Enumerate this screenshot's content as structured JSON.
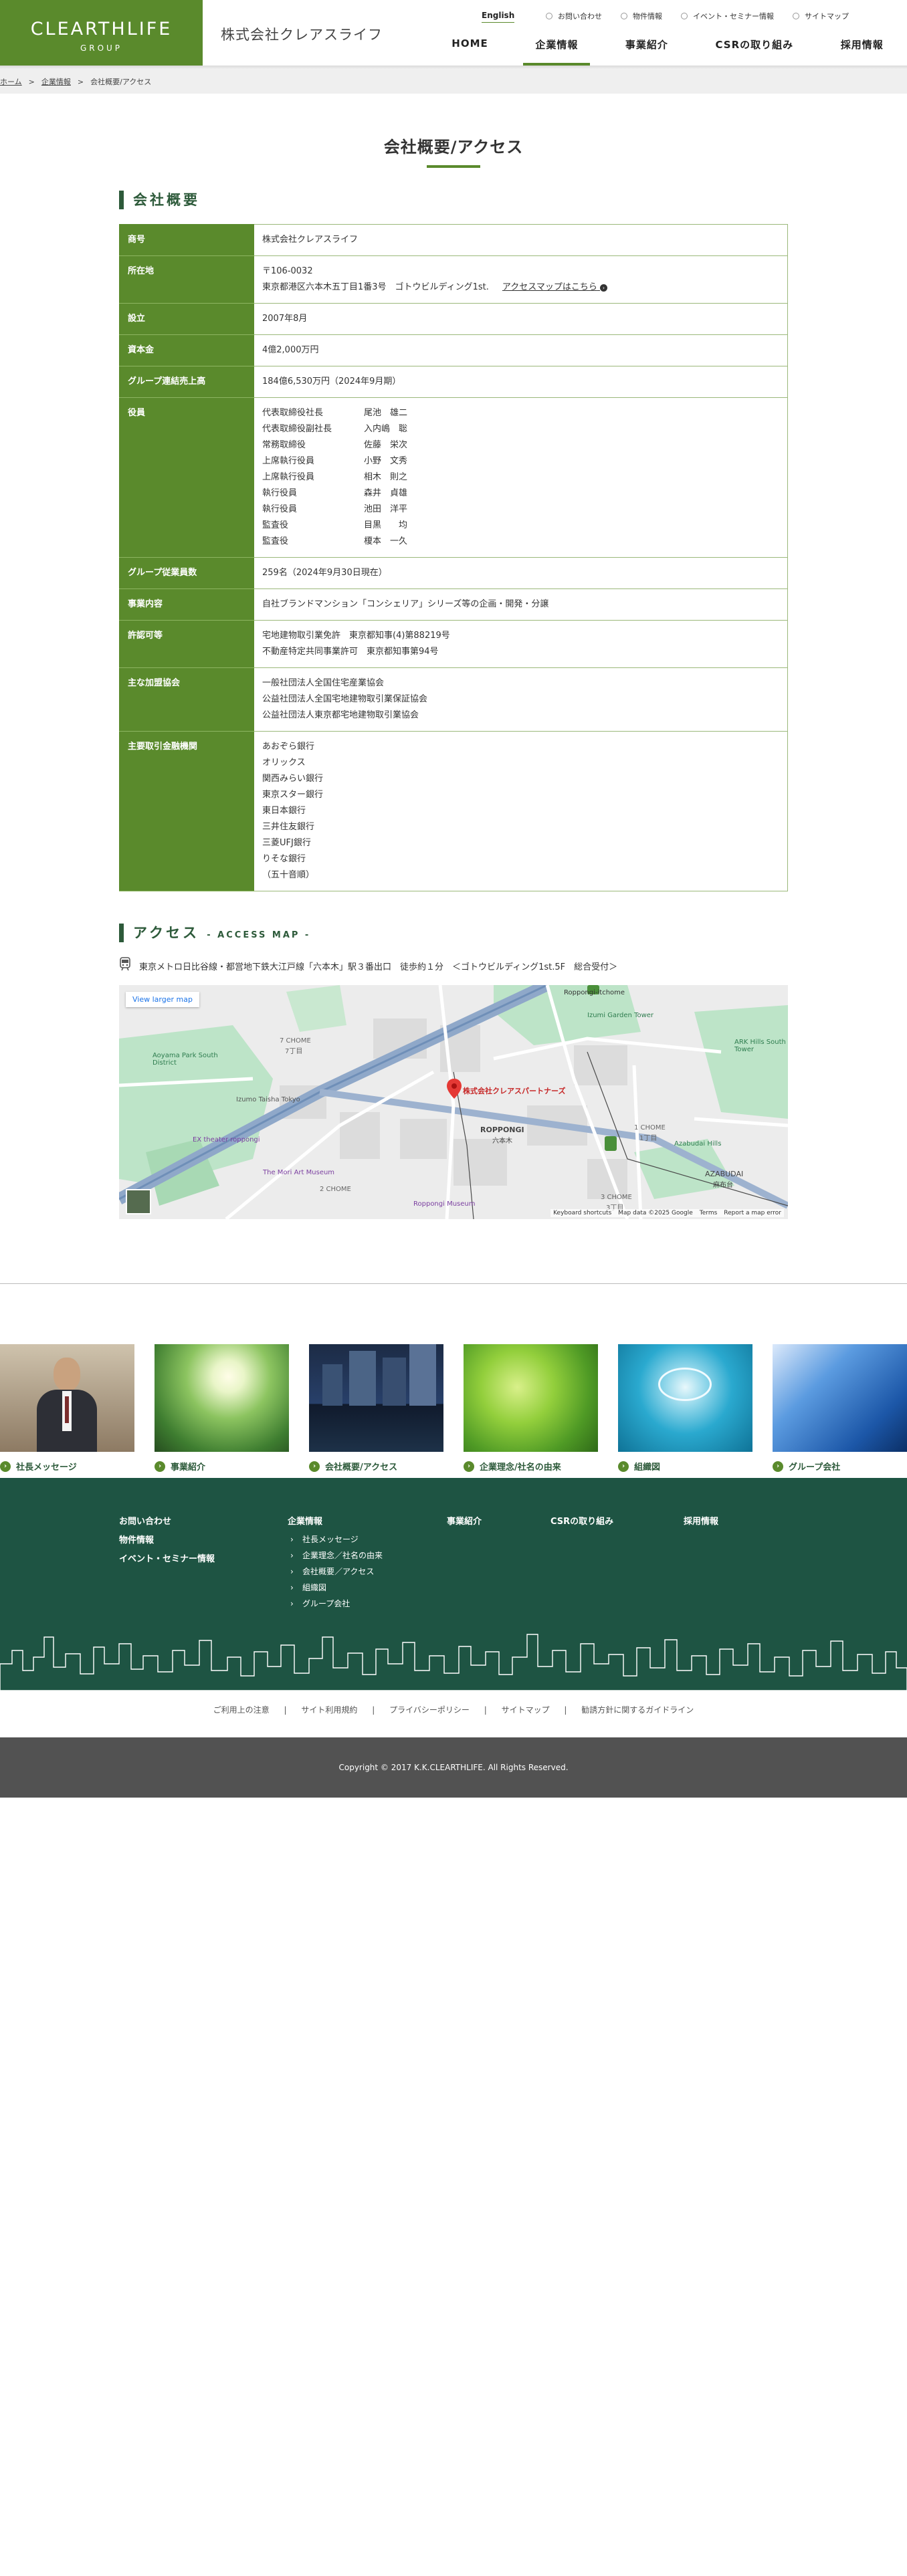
{
  "header": {
    "logo_main": "CLEARTHLIFE",
    "logo_sub": "GROUP",
    "company_name": "株式会社クレアスライフ",
    "english": "English",
    "util_nav": [
      "お問い合わせ",
      "物件情報",
      "イベント・セミナー情報",
      "サイトマップ"
    ],
    "global_nav": [
      "HOME",
      "企業情報",
      "事業紹介",
      "CSRの取り組み",
      "採用情報"
    ],
    "active_nav": "企業情報"
  },
  "breadcrumb": {
    "items": [
      "ホーム",
      "企業情報",
      "会社概要/アクセス"
    ],
    "separator": ">"
  },
  "page": {
    "title": "会社概要/アクセス",
    "company_section": "会社概要",
    "access_section": "アクセス",
    "access_sub": "- ACCESS MAP -"
  },
  "company_table": {
    "trade_name_label": "商号",
    "trade_name": "株式会社クレアスライフ",
    "address_label": "所在地",
    "postal": "〒106-0032",
    "address": "東京都港区六本木五丁目1番3号　ゴトウビルディング1st.",
    "map_link": "アクセスマップはこちら",
    "established_label": "設立",
    "established": "2007年8月",
    "capital_label": "資本金",
    "capital": "4億2,000万円",
    "sales_label": "グループ連結売上高",
    "sales": "184億6,530万円（2024年9月期）",
    "officers_label": "役員",
    "officers": [
      {
        "role": "代表取締役社長",
        "name": "尾池　雄二"
      },
      {
        "role": "代表取締役副社長",
        "name": "入内嶋　聡"
      },
      {
        "role": "常務取締役",
        "name": "佐藤　栄次"
      },
      {
        "role": "上席執行役員",
        "name": "小野　文秀"
      },
      {
        "role": "上席執行役員",
        "name": "相木　則之"
      },
      {
        "role": "執行役員",
        "name": "森井　貞雄"
      },
      {
        "role": "執行役員",
        "name": "池田　洋平"
      },
      {
        "role": "監査役",
        "name": "目黒　　均"
      },
      {
        "role": "監査役",
        "name": "榎本　一久"
      }
    ],
    "employees_label": "グループ従業員数",
    "employees": "259名（2024年9月30日現在）",
    "business_label": "事業内容",
    "business": "自社ブランドマンション「コンシェリア」シリーズ等の企画・開発・分譲",
    "license_label": "許認可等",
    "licenses": [
      "宅地建物取引業免許　東京都知事(4)第88219号",
      "不動産特定共同事業許可　東京都知事第94号"
    ],
    "associations_label": "主な加盟協会",
    "associations": [
      "一般社団法人全国住宅産業協会",
      "公益社団法人全国宅地建物取引業保証協会",
      "公益社団法人東京都宅地建物取引業協会"
    ],
    "banks_label": "主要取引金融機関",
    "banks": [
      "あおぞら銀行",
      "オリックス",
      "関西みらい銀行",
      "東京スター銀行",
      "東日本銀行",
      "三井住友銀行",
      "三菱UFJ銀行",
      "りそな銀行",
      "（五十音順）"
    ]
  },
  "access": {
    "route": "東京メトロ日比谷線・都営地下鉄大江戸線「六本木」駅３番出口　徒歩約１分　＜ゴトウビルディング1st.5F　総合受付＞",
    "map_button": "View larger map",
    "map_pin_label": "株式会社クレアスパートナーズ",
    "map_labels": [
      "7 CHOME",
      "7丁目",
      "Aoyama Park South District",
      "Izumo Taisha Tokyo",
      "EX theater roppongi",
      "The Mori Art Museum",
      "ROPPONGI",
      "六本木",
      "1 CHOME",
      "1丁目",
      "Azabudai Hills",
      "AZABUDAI",
      "麻布台",
      "Roppongi Museum",
      "Roppongi-itchome",
      "Izumi Garden Tower",
      "ARK Hills South Tower",
      "3 CHOME",
      "3丁目",
      "2 CHOME"
    ],
    "map_footer": [
      "Keyboard shortcuts",
      "Map data ©2025 Google",
      "Terms",
      "Report a map error"
    ]
  },
  "cards": [
    {
      "label": "社長メッセージ",
      "color": "#7b6a58"
    },
    {
      "label": "事業紹介",
      "color": "#5f9d3a"
    },
    {
      "label": "会社概要/アクセス",
      "color": "#1f3550"
    },
    {
      "label": "企業理念/社名の由来",
      "color": "#6fb337"
    },
    {
      "label": "組織図",
      "color": "#1aa3c8"
    },
    {
      "label": "グループ会社",
      "color": "#2f72c2"
    }
  ],
  "footer": {
    "col1": [
      "お問い合わせ",
      "物件情報",
      "イベント・セミナー情報"
    ],
    "col2_title": "企業情報",
    "col2_items": [
      "社長メッセージ",
      "企業理念／社名の由来",
      "会社概要／アクセス",
      "組織図",
      "グループ会社"
    ],
    "col3": "事業紹介",
    "col4": "CSRの取り組み",
    "col5": "採用情報",
    "bottom_links": [
      "ご利用上の注意",
      "サイト利用規約",
      "プライバシーポリシー",
      "サイトマップ",
      "勧誘方針に関するガイドライン"
    ],
    "copyright": "Copyright © 2017 K.K.CLEARTHLIFE. All Rights Reserved."
  },
  "colors": {
    "brand_green": "#5a8a2c",
    "footer_green": "#1e5443",
    "heading_green": "#2d5a3a"
  }
}
